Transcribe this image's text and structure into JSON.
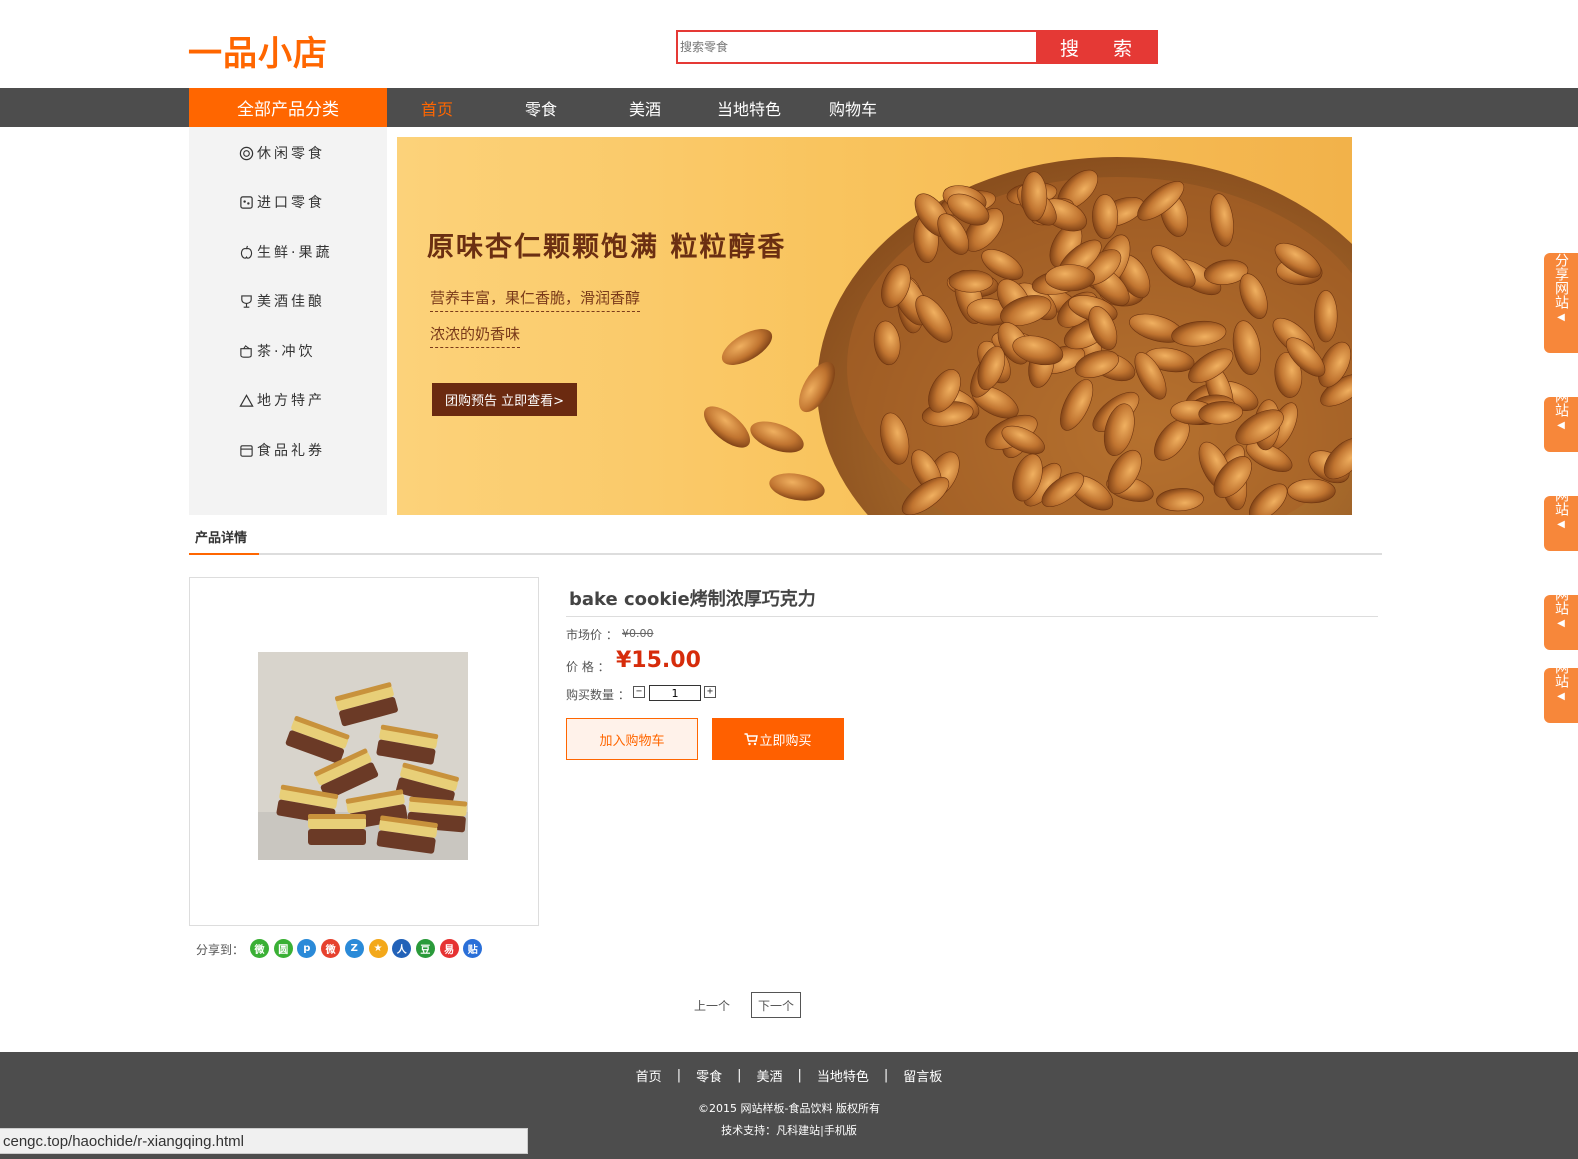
{
  "header": {
    "logo": "一品小店",
    "search_placeholder": "搜索零食",
    "search_button": "搜 索"
  },
  "nav": {
    "all_categories": "全部产品分类",
    "items": [
      "首页",
      "零食",
      "美酒",
      "当地特色",
      "购物车"
    ],
    "active_index": 0
  },
  "sidebar": {
    "items": [
      {
        "label": "休闲零食",
        "icon": "snack-icon"
      },
      {
        "label": "进口零食",
        "icon": "import-icon"
      },
      {
        "label": "生鲜·果蔬",
        "icon": "fruit-icon"
      },
      {
        "label": "美酒佳酿",
        "icon": "wine-glass-icon"
      },
      {
        "label": "茶·冲饮",
        "icon": "tea-cup-icon"
      },
      {
        "label": "地方特产",
        "icon": "mountain-icon"
      },
      {
        "label": "食品礼券",
        "icon": "gift-box-icon"
      }
    ]
  },
  "banner": {
    "title": "原味杏仁颗颗饱满 粒粒醇香",
    "sub1": "营养丰富，果仁香脆，滑润香醇",
    "sub2": "浓浓的奶香味",
    "button": "团购预告 立即查看>"
  },
  "section": {
    "tab": "产品详情"
  },
  "product": {
    "title": "bake cookie烤制浓厚巧克力",
    "market_price_label": "市场价 ：",
    "market_price": "¥0.00",
    "price_label": "价 格 ：",
    "price": "¥15.00",
    "qty_label": "购买数量 ：",
    "qty_minus": "−",
    "qty_value": "1",
    "qty_plus": "+",
    "add_cart": "加入购物车",
    "buy_now": "立即购买",
    "share_label": "分享到："
  },
  "share_icons": [
    {
      "name": "wechat-icon",
      "glyph": "微",
      "color": "#3ab035"
    },
    {
      "name": "moments-icon",
      "glyph": "圆",
      "color": "#3ab035"
    },
    {
      "name": "pengyou-icon",
      "glyph": "p",
      "color": "#2a8ad8"
    },
    {
      "name": "weibo-icon",
      "glyph": "微",
      "color": "#e6412e"
    },
    {
      "name": "qzone-icon",
      "glyph": "Z",
      "color": "#2a8ad8"
    },
    {
      "name": "qq-star-icon",
      "glyph": "★",
      "color": "#f3a81a"
    },
    {
      "name": "renren-icon",
      "glyph": "人",
      "color": "#2262b8"
    },
    {
      "name": "douban-icon",
      "glyph": "豆",
      "color": "#2a9a3a"
    },
    {
      "name": "netease-icon",
      "glyph": "易",
      "color": "#e63232"
    },
    {
      "name": "tieba-icon",
      "glyph": "贴",
      "color": "#2a6fd8"
    }
  ],
  "pager": {
    "prev": "上一个",
    "next": "下一个"
  },
  "footer": {
    "links": [
      "首页",
      "零食",
      "美酒",
      "当地特色",
      "留言板"
    ],
    "separator": "|",
    "copyright": "©2015 网站样板-食品饮料 版权所有",
    "support": "技术支持：凡科建站|手机版"
  },
  "status_bar": {
    "url": "cengc.top/haochide/r-xiangqing.html"
  },
  "float_tabs": [
    {
      "label": "分享网站"
    },
    {
      "label": "网站"
    },
    {
      "label": "网站"
    },
    {
      "label": "网站"
    },
    {
      "label": "网站"
    }
  ],
  "colors": {
    "brand": "#ff6600",
    "search_red": "#e53935",
    "nav_bg": "#4d4d4d",
    "price_red": "#d62c0b"
  }
}
